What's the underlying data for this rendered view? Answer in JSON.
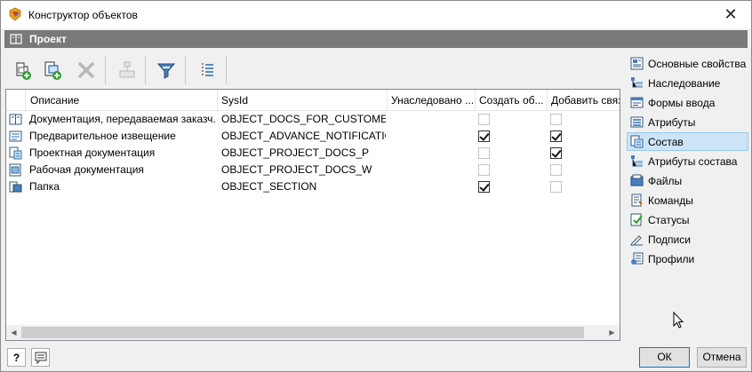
{
  "window": {
    "title": "Конструктор объектов",
    "close_glyph": "✕"
  },
  "header": {
    "title": "Проект",
    "icon": "book-icon"
  },
  "toolbar": {
    "buttons": [
      {
        "name": "add-object-icon"
      },
      {
        "name": "add-linked-object-icon"
      },
      {
        "name": "delete-icon",
        "disabled": true
      },
      {
        "name": "hierarchy-icon",
        "disabled": true
      },
      {
        "name": "filter-icon"
      },
      {
        "name": "column-settings-icon"
      }
    ]
  },
  "grid": {
    "columns": [
      "Описание",
      "SysId",
      "Унаследовано ...",
      "Создать об...",
      "Добавить связь"
    ],
    "rows": [
      {
        "icon": "book-icon",
        "description": "Документация, передаваемая заказч...",
        "sysid": "OBJECT_DOCS_FOR_CUSTOMER",
        "create": false,
        "add_link": false
      },
      {
        "icon": "notice-icon",
        "description": "Предварительное извещение",
        "sysid": "OBJECT_ADVANCE_NOTIFICATION",
        "create": true,
        "add_link": true
      },
      {
        "icon": "project-doc-icon",
        "description": "Проектная документация",
        "sysid": "OBJECT_PROJECT_DOCS_P",
        "create": false,
        "add_link": true
      },
      {
        "icon": "work-doc-icon",
        "description": "Рабочая документация",
        "sysid": "OBJECT_PROJECT_DOCS_W",
        "create": false,
        "add_link": false
      },
      {
        "icon": "folder-icon",
        "description": "Папка",
        "sysid": "OBJECT_SECTION",
        "create": true,
        "add_link": false
      }
    ]
  },
  "sidebar": {
    "items": [
      {
        "label": "Основные свойства",
        "icon": "properties-icon"
      },
      {
        "label": "Наследование",
        "icon": "inheritance-icon"
      },
      {
        "label": "Формы ввода",
        "icon": "forms-icon"
      },
      {
        "label": "Атрибуты",
        "icon": "attributes-icon"
      },
      {
        "label": "Состав",
        "icon": "composition-icon",
        "active": true
      },
      {
        "label": "Атрибуты состава",
        "icon": "composition-attributes-icon"
      },
      {
        "label": "Файлы",
        "icon": "files-icon"
      },
      {
        "label": "Команды",
        "icon": "commands-icon"
      },
      {
        "label": "Статусы",
        "icon": "statuses-icon"
      },
      {
        "label": "Подписи",
        "icon": "signatures-icon"
      },
      {
        "label": "Профили",
        "icon": "profiles-icon"
      }
    ]
  },
  "footer": {
    "ok": "ОК",
    "cancel": "Отмена",
    "help_glyph": "?"
  }
}
